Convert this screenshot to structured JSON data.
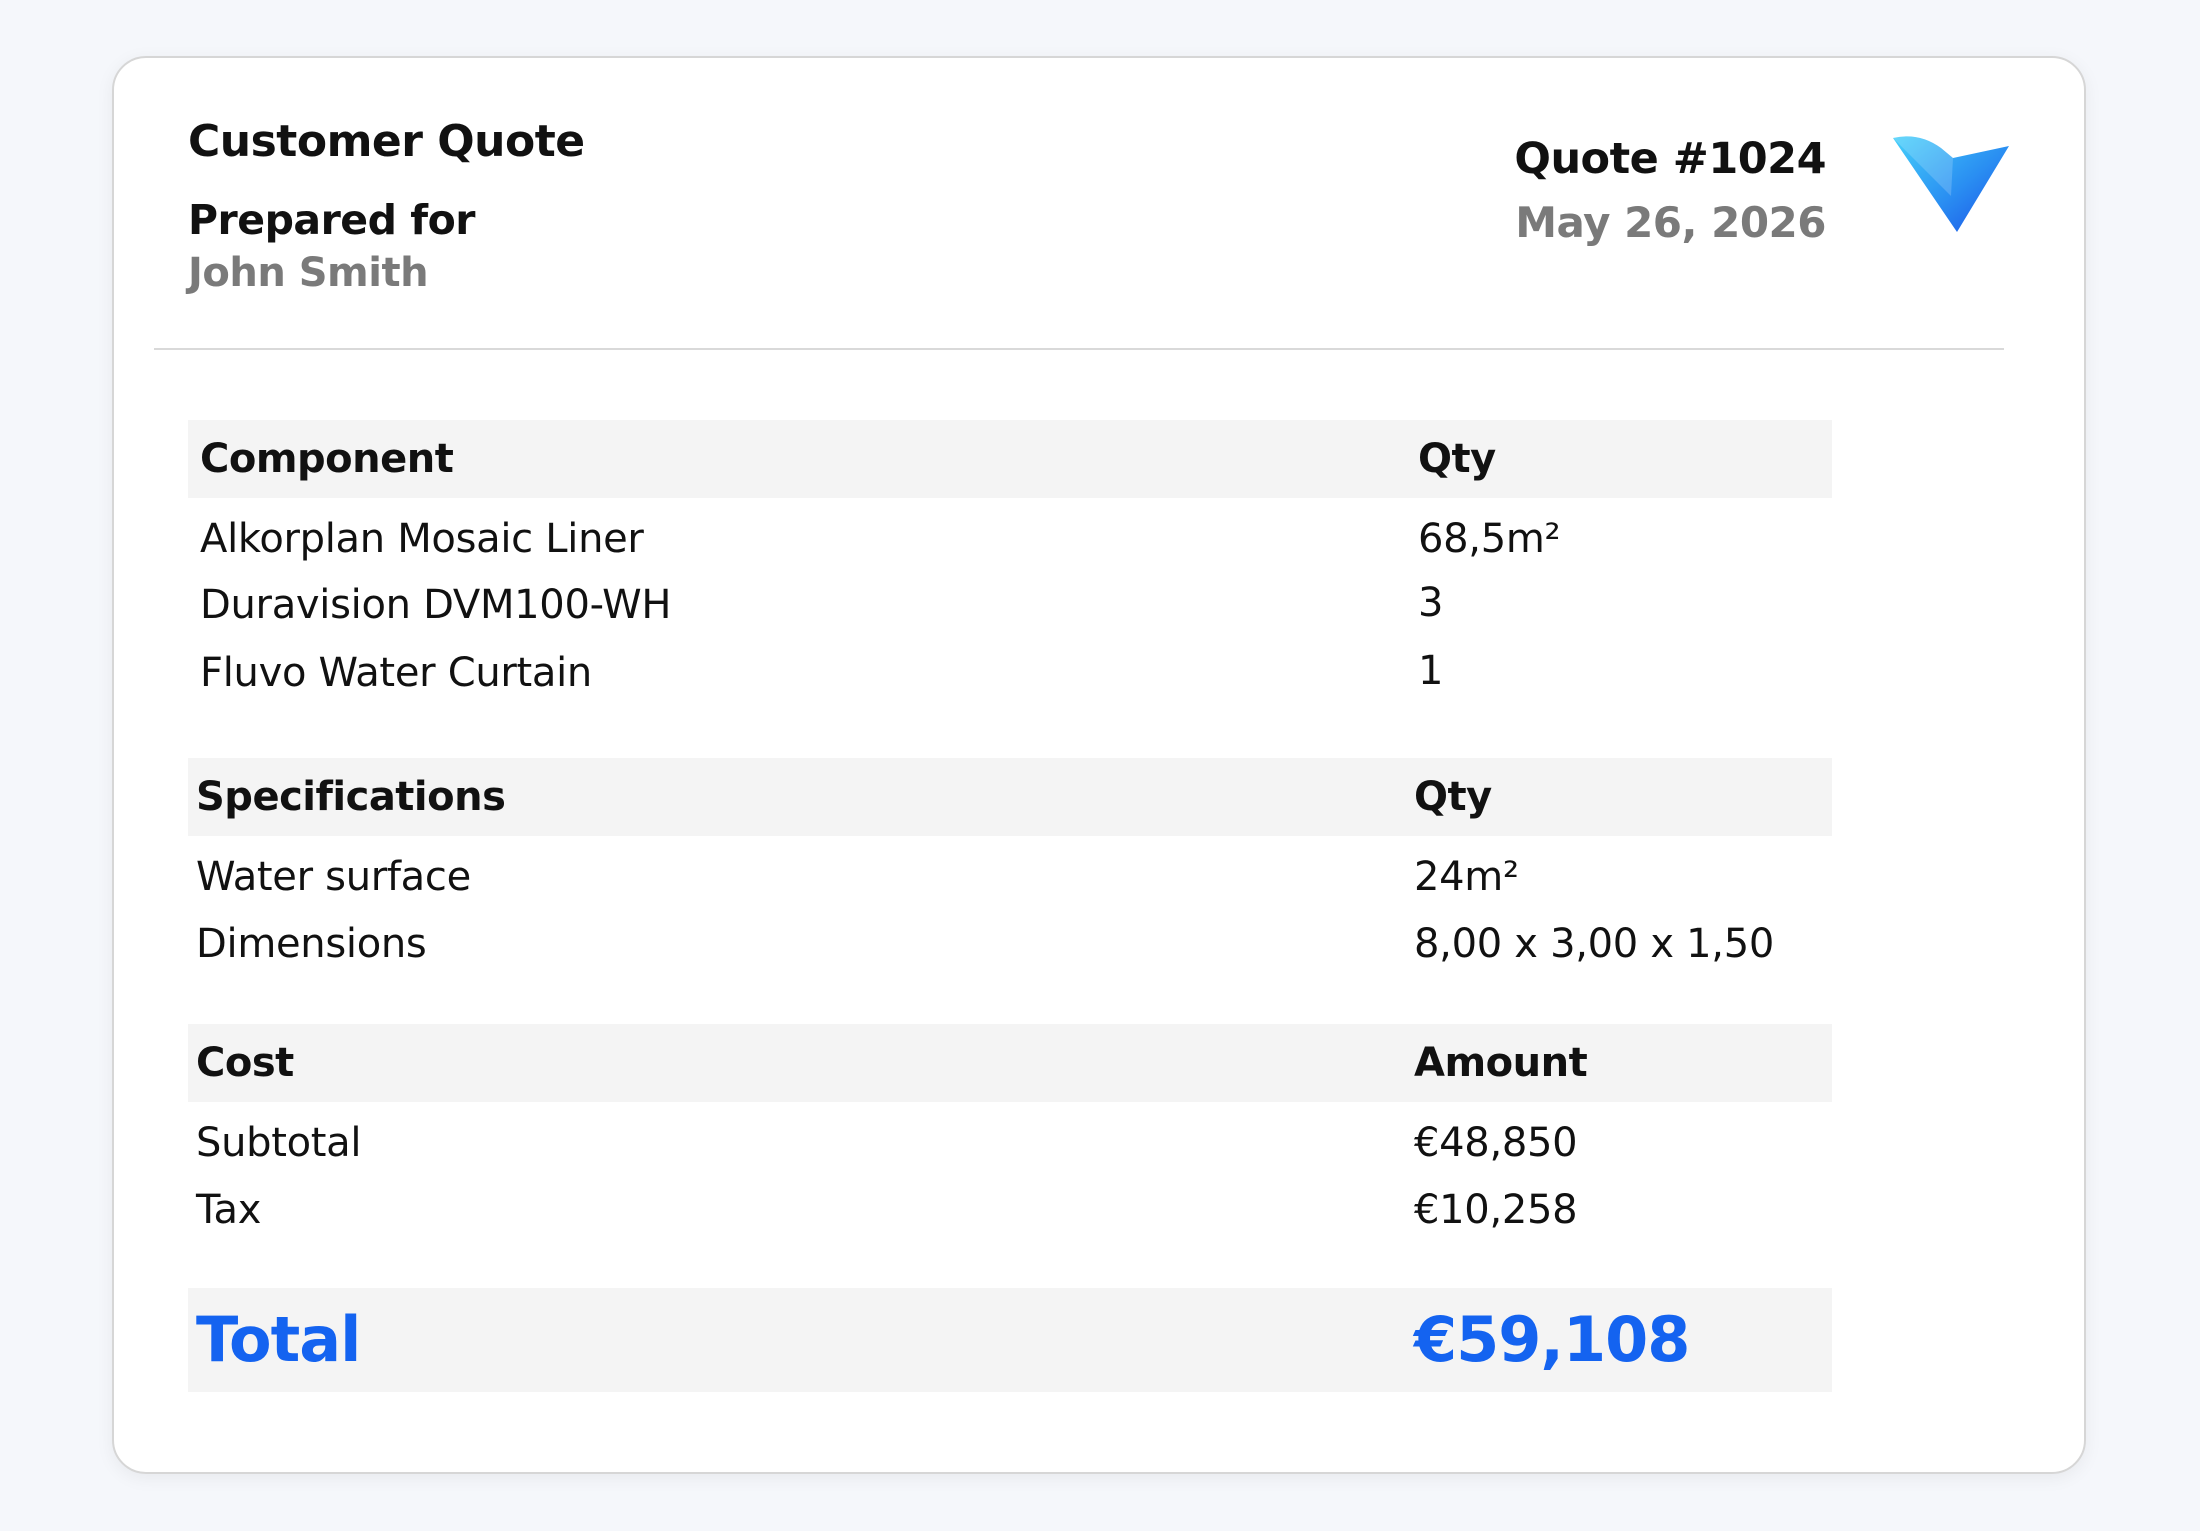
{
  "header": {
    "title": "Customer Quote",
    "prepared_label": "Prepared for",
    "customer_name": "John Smith",
    "quote_number": "Quote #1024",
    "date": "May 26, 2026",
    "logo": "checkmark-v-logo"
  },
  "components": {
    "header_label": "Component",
    "header_value": "Qty",
    "rows": [
      {
        "label": "Alkorplan Mosaic Liner",
        "value": "68,5m²"
      },
      {
        "label": "Duravision DVM100-WH",
        "value": "3"
      },
      {
        "label": "Fluvo Water Curtain",
        "value": "1"
      }
    ]
  },
  "specifications": {
    "header_label": "Specifications",
    "header_value": "Qty",
    "rows": [
      {
        "label": "Water surface",
        "value": "24m²"
      },
      {
        "label": "Dimensions",
        "value": "8,00 x 3,00 x 1,50"
      }
    ]
  },
  "cost": {
    "header_label": "Cost",
    "header_value": "Amount",
    "rows": [
      {
        "label": "Subtotal",
        "value": "€48,850"
      },
      {
        "label": "Tax",
        "value": "€10,258"
      }
    ]
  },
  "total": {
    "label": "Total",
    "value": "€59,108"
  },
  "colors": {
    "accent": "#1463f0",
    "muted_text": "#7a7a7a",
    "header_fill": "#f4f4f4",
    "logo_light": "#3fc3f7",
    "logo_dark": "#1a56e8"
  }
}
